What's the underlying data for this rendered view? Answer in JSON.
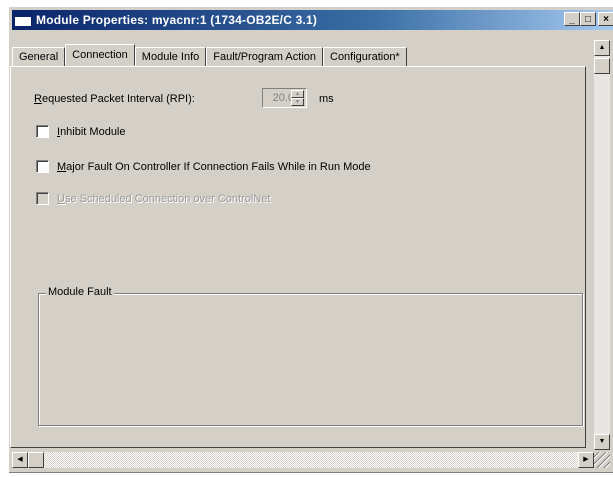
{
  "window": {
    "title": "Module Properties: myacnr:1 (1734-OB2E/C 3.1)",
    "controls": {
      "minimize": "_",
      "maximize": "□",
      "close": "×"
    }
  },
  "tabs": [
    {
      "label": "General",
      "active": false
    },
    {
      "label": "Connection",
      "active": true
    },
    {
      "label": "Module Info",
      "active": false
    },
    {
      "label": "Fault/Program Action",
      "active": false
    },
    {
      "label": "Configuration*",
      "active": false
    }
  ],
  "connection": {
    "rpi": {
      "label_mnemonic": "R",
      "label_rest": "equested Packet Interval (RPI):",
      "value": "20.0",
      "units": "ms"
    },
    "inhibit_module": {
      "mnemonic": "I",
      "label_rest": "nhibit Module",
      "checked": false,
      "enabled": true
    },
    "major_fault": {
      "mnemonic": "M",
      "label_rest": "ajor Fault On Controller If Connection Fails While in Run Mode",
      "checked": false,
      "enabled": true
    },
    "scheduled_connection": {
      "mnemonic": "U",
      "label_rest": "se Scheduled Connection over ControlNet",
      "checked": false,
      "enabled": false
    }
  },
  "module_fault": {
    "label": "Module Fault",
    "text": ""
  },
  "colors": {
    "title_bar_start": "#0a246a",
    "title_bar_end": "#a6caf0",
    "face": "#d4d0c8"
  }
}
